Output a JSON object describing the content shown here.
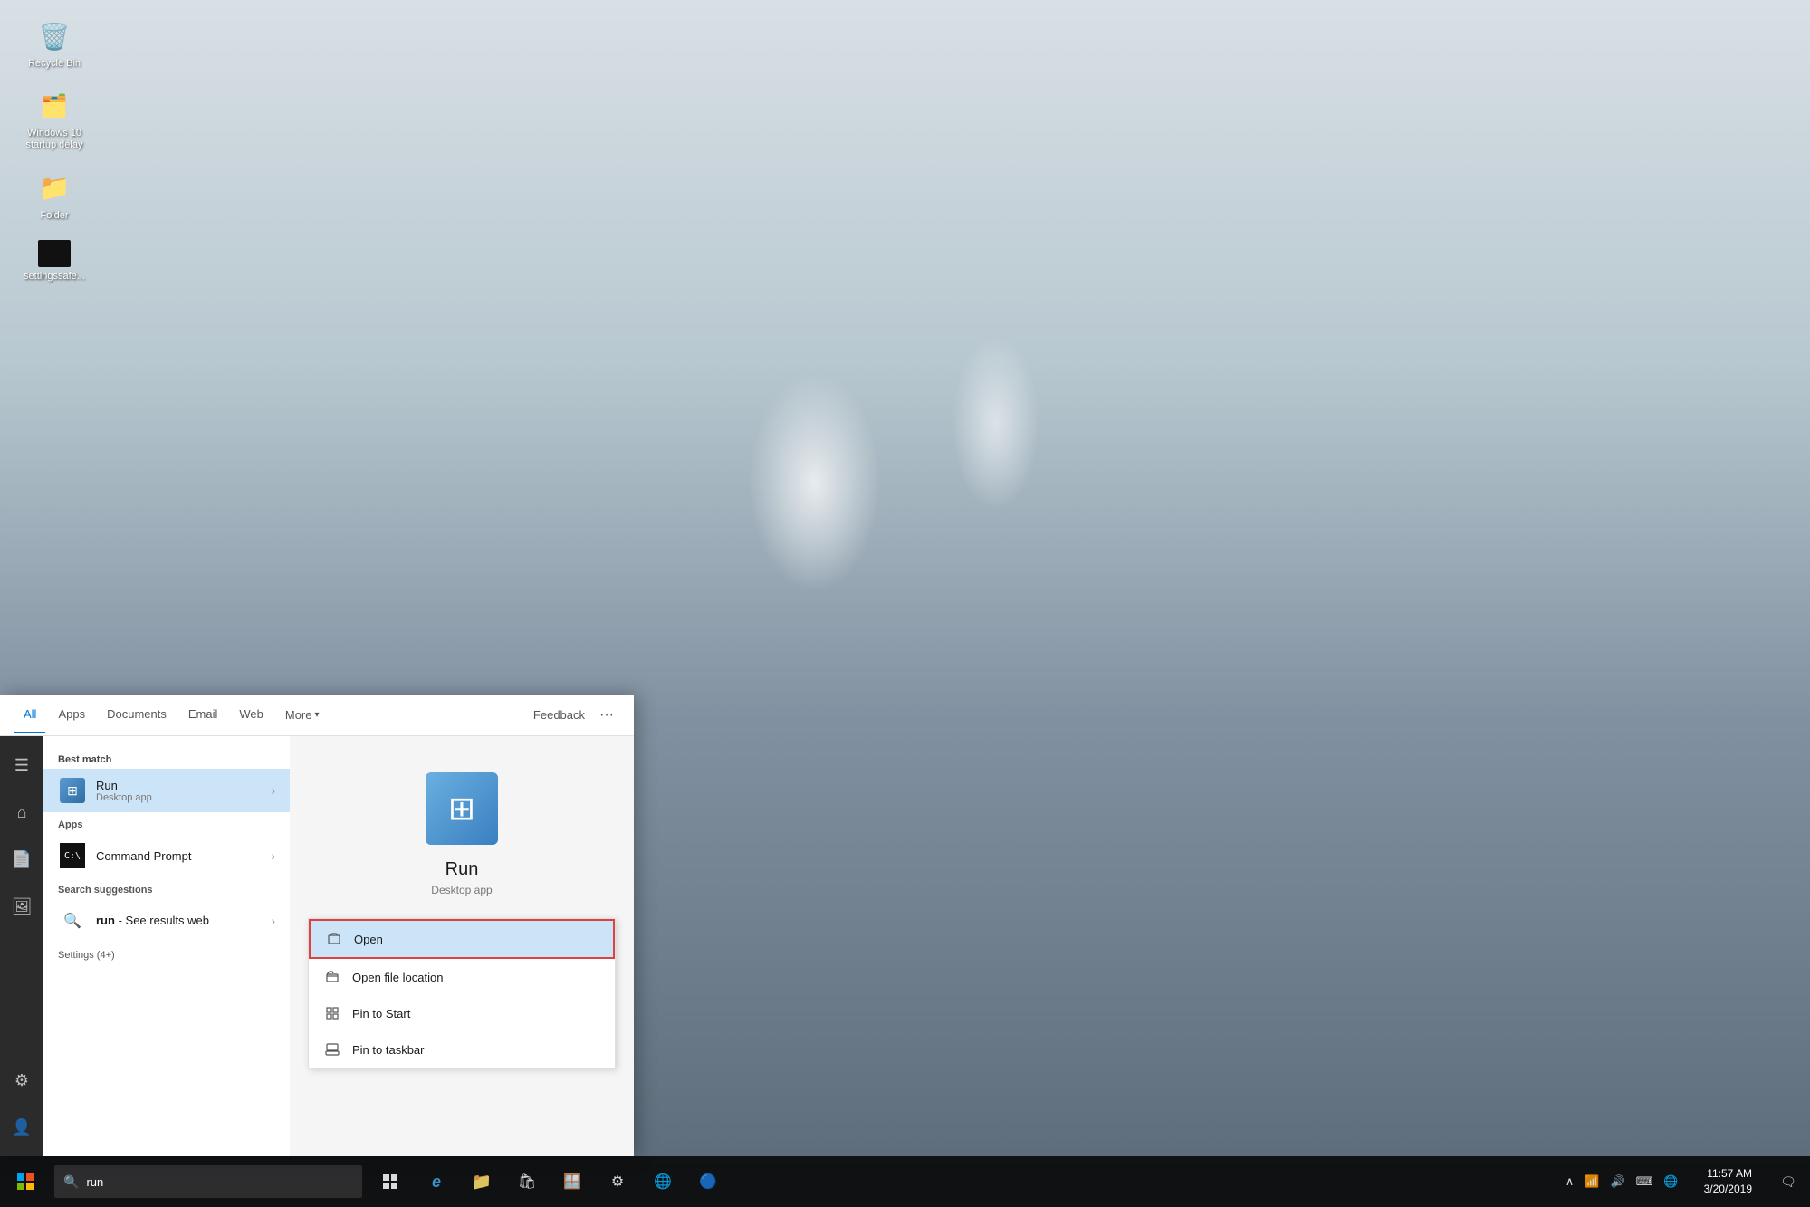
{
  "desktop": {
    "icons": [
      {
        "id": "recycle-bin",
        "label": "Recycle Bin",
        "icon": "🗑️"
      },
      {
        "id": "windows10-startup",
        "label": "Windows 10 startup delay",
        "icon": "🗂️"
      },
      {
        "id": "folder",
        "label": "Folder",
        "icon": "📁"
      },
      {
        "id": "settingssafe",
        "label": "settingssafe...",
        "icon": "🖥️"
      }
    ]
  },
  "taskbar": {
    "search_placeholder": "run",
    "search_value": "run",
    "time": "11:57 AM",
    "date": "3/20/2019",
    "buttons": [
      {
        "id": "task-view",
        "icon": "⊞"
      },
      {
        "id": "edge",
        "icon": "e"
      },
      {
        "id": "file-explorer",
        "icon": "📁"
      },
      {
        "id": "store",
        "icon": "🛍️"
      },
      {
        "id": "windows-store",
        "icon": "🪟"
      },
      {
        "id": "settings",
        "icon": "⚙️"
      },
      {
        "id": "chrome",
        "icon": "●"
      },
      {
        "id": "network",
        "icon": "🌐"
      }
    ]
  },
  "search_panel": {
    "tabs": [
      {
        "id": "all",
        "label": "All",
        "active": true
      },
      {
        "id": "apps",
        "label": "Apps"
      },
      {
        "id": "documents",
        "label": "Documents"
      },
      {
        "id": "email",
        "label": "Email"
      },
      {
        "id": "web",
        "label": "Web"
      },
      {
        "id": "more",
        "label": "More"
      }
    ],
    "feedback_label": "Feedback",
    "sections": {
      "best_match": {
        "header": "Best match",
        "item": {
          "title": "Run",
          "subtitle": "Desktop app",
          "icon": "run"
        }
      },
      "apps": {
        "header": "Apps",
        "items": [
          {
            "title": "Command Prompt",
            "subtitle": ""
          }
        ]
      },
      "search_suggestions": {
        "header": "Search suggestions",
        "items": [
          {
            "title": "run",
            "subtitle": "See results web",
            "dash": " - "
          }
        ]
      },
      "settings": {
        "header": "Settings (4+)"
      }
    },
    "right_panel": {
      "app_name": "Run",
      "app_type": "Desktop app",
      "context_menu": [
        {
          "id": "open",
          "label": "Open",
          "icon": "↗"
        },
        {
          "id": "open-file-location",
          "label": "Open file location",
          "icon": "📄"
        },
        {
          "id": "pin-to-start",
          "label": "Pin to Start",
          "icon": "📌"
        },
        {
          "id": "pin-to-taskbar",
          "label": "Pin to taskbar",
          "icon": "📌"
        }
      ]
    }
  }
}
